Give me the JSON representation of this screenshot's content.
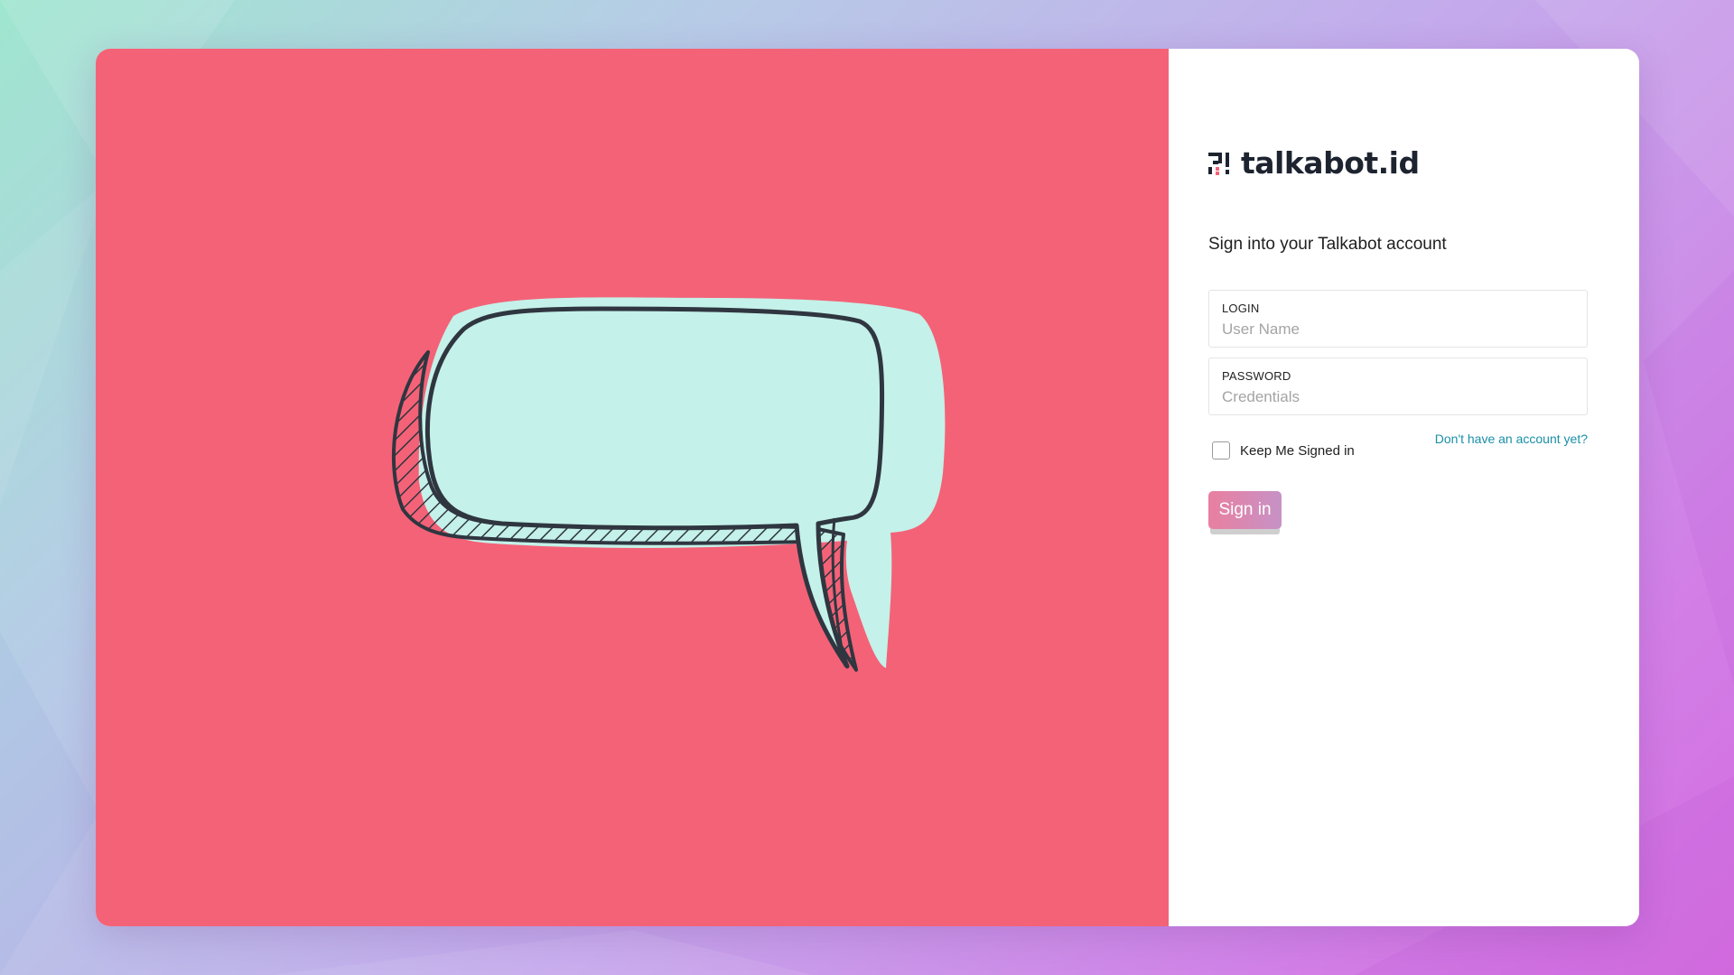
{
  "brand": {
    "name": "talkabot.id",
    "accent_color": "#f46277",
    "bubble_color": "#c4f1e9",
    "link_color": "#1a8fa7"
  },
  "hero": {
    "illustration": "speech-bubble"
  },
  "form": {
    "title": "Sign into your Talkabot account",
    "login": {
      "label": "LOGIN",
      "placeholder": "User Name",
      "value": ""
    },
    "password": {
      "label": "PASSWORD",
      "placeholder": "Credentials",
      "value": ""
    },
    "remember": {
      "label": "Keep Me Signed in",
      "checked": false
    },
    "signup_link": "Don't have an account yet?",
    "submit_label": "Sign in"
  }
}
